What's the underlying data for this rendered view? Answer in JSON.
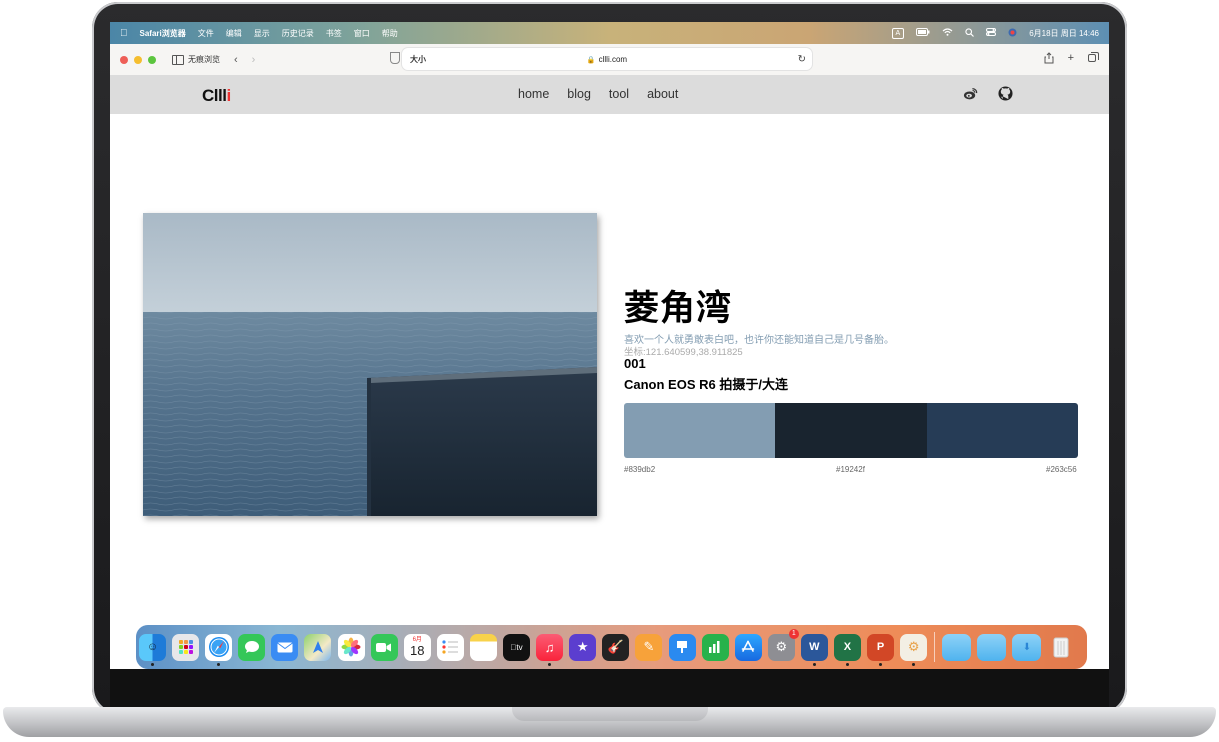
{
  "menubar": {
    "app_name": "Safari浏览器",
    "menus": [
      "文件",
      "编辑",
      "显示",
      "历史记录",
      "书签",
      "窗口",
      "帮助"
    ],
    "input_indicator": "A",
    "clock": "6月18日 周日  14:46"
  },
  "toolbar": {
    "private_label": "无痕浏览",
    "reader_label": "大小",
    "url": "cllli.com"
  },
  "site": {
    "logo_text": "Clll",
    "logo_accent": "i",
    "nav": [
      "home",
      "blog",
      "tool",
      "about"
    ],
    "social_icons": [
      "weibo-icon",
      "github-icon"
    ]
  },
  "post": {
    "title": "菱角湾",
    "subtitle": "喜欢一个人就勇敢表白吧，也许你还能知道自己是几号备胎。",
    "coords": "坐标:121.640599,38.911825",
    "number": "001",
    "camera": "Canon EOS R6 拍摄于/大连",
    "palette": [
      {
        "hex": "#839db2",
        "label": "#839db2"
      },
      {
        "hex": "#19242f",
        "label": "#19242f"
      },
      {
        "hex": "#263c56",
        "label": "#263c56"
      }
    ]
  },
  "dock": {
    "calendar_month": "6月",
    "calendar_day": "18",
    "badge_count": "1",
    "apps": [
      "finder",
      "launchpad",
      "safari",
      "messages",
      "mail",
      "maps",
      "photos",
      "facetime",
      "calendar",
      "reminders",
      "notes",
      "tv",
      "music",
      "imovie",
      "garageband",
      "pages",
      "keynote",
      "numbers",
      "app-store",
      "system-settings",
      "word",
      "excel",
      "powerpoint",
      "preview",
      "folder",
      "folder",
      "downloads",
      "trash"
    ]
  }
}
